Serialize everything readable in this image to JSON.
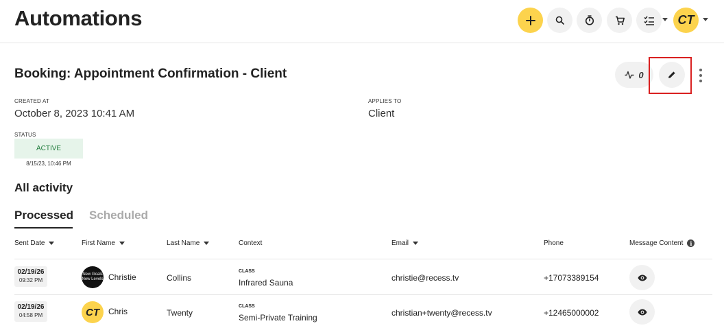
{
  "header": {
    "title": "Automations",
    "avatar_initials": "CT",
    "icons": [
      "plus-icon",
      "search-icon",
      "stopwatch-icon",
      "cart-icon",
      "checklist-icon"
    ],
    "accent_color": "#fcd34d"
  },
  "automation": {
    "title": "Booking: Appointment Confirmation - Client",
    "activity_count": "0",
    "created_at_label": "CREATED AT",
    "created_at_value": "October 8, 2023 10:41 AM",
    "applies_to_label": "APPLIES TO",
    "applies_to_value": "Client",
    "status_label": "STATUS",
    "status_value": "ACTIVE",
    "status_date": "8/15/23, 10:46 PM",
    "status_color": "#1e7a3a"
  },
  "activity": {
    "section_title": "All activity",
    "tabs": [
      {
        "label": "Processed",
        "active": true
      },
      {
        "label": "Scheduled",
        "active": false
      }
    ],
    "columns": {
      "sent_date": "Sent Date",
      "first_name": "First Name",
      "last_name": "Last Name",
      "context": "Context",
      "email": "Email",
      "phone": "Phone",
      "message_content": "Message Content"
    },
    "rows": [
      {
        "date": "02/19/26",
        "time": "09:32 PM",
        "avatar_text": "New Goals New Levels",
        "first_name": "Christie",
        "last_name": "Collins",
        "context_label": "CLASS",
        "context_value": "Infrared Sauna",
        "email": "christie@recess.tv",
        "phone": "+17073389154"
      },
      {
        "date": "02/19/26",
        "time": "04:58 PM",
        "avatar_text": "CT",
        "first_name": "Chris",
        "last_name": "Twenty",
        "context_label": "CLASS",
        "context_value": "Semi-Private Training",
        "email": "christian+twenty@recess.tv",
        "phone": "+12465000002"
      }
    ]
  }
}
